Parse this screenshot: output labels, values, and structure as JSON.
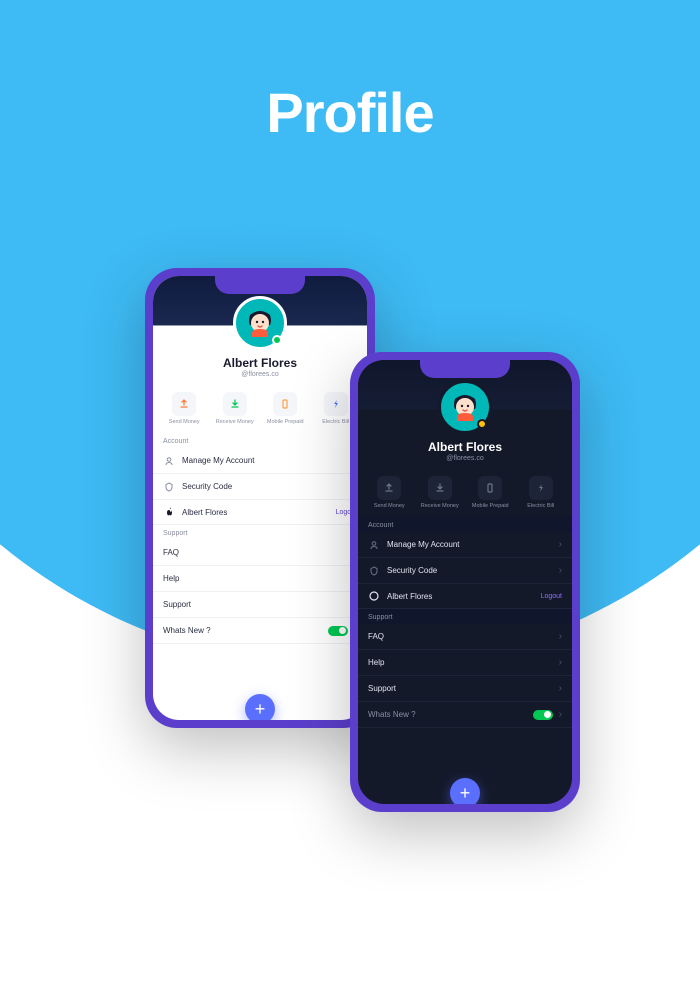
{
  "page_title": "Profile",
  "user": {
    "name": "Albert Flores",
    "handle": "@florees.co"
  },
  "actions": {
    "send": "Send Money",
    "receive": "Receive Money",
    "prepaid": "Mobile Prepaid",
    "bill": "Electric Bill"
  },
  "sections": {
    "account": "Account",
    "support": "Support"
  },
  "rows": {
    "manage": "Manage My Account",
    "security": "Security Code",
    "apple": "Albert Flores",
    "logout": "Logout",
    "faq": "FAQ",
    "help": "Help",
    "support": "Support",
    "whats": "Whats New ?"
  },
  "colors": {
    "send": "#FF7A3D",
    "receive": "#00C853",
    "prepaid": "#FF9F43",
    "bill": "#4A7BFF"
  }
}
